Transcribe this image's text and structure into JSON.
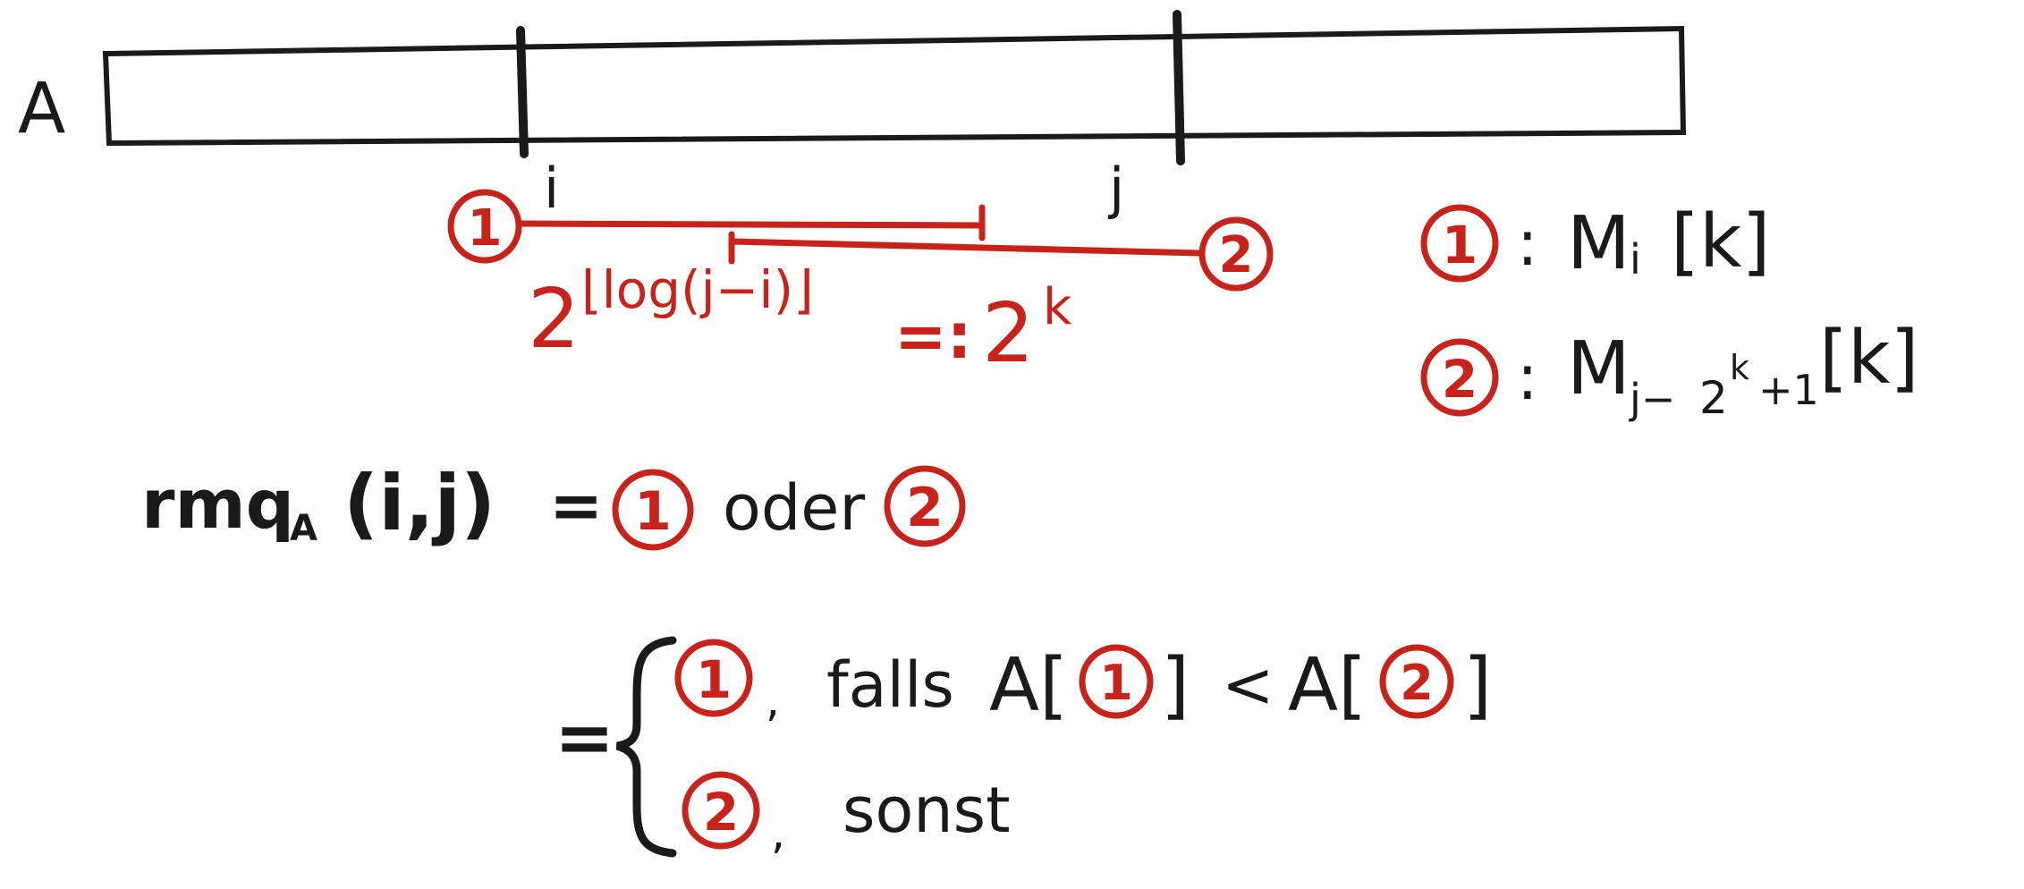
{
  "colors": {
    "ink": "#1a1a1a",
    "red": "#c8231b",
    "paper": "#ffffff"
  },
  "array": {
    "name": "A",
    "index_i": "i",
    "index_j": "j"
  },
  "markers": {
    "one": "1",
    "two": "2"
  },
  "span_label": {
    "base": "2",
    "exponent": "⌊log(j−i)⌋",
    "defines": "=:",
    "result_base": "2",
    "result_exp": "k"
  },
  "legend": {
    "item1": {
      "colon": ":",
      "symbol": "M",
      "subscript": "i",
      "bracket": "[k]"
    },
    "item2": {
      "colon": ":",
      "symbol": "M",
      "sub_a": "j−",
      "sub_b": "2",
      "sub_exp": "k",
      "sub_c": "+1",
      "bracket": "[k]"
    }
  },
  "formula": {
    "lhs_name": "rmq",
    "lhs_sub": "A",
    "lhs_args": "(i,j)",
    "equals": "=",
    "oder": "oder"
  },
  "cases": {
    "equals": "=",
    "row1_sep": ",",
    "row1_falls": "falls",
    "row1_a1": "A[",
    "row1_close1": "]",
    "row1_lt": "<",
    "row1_a2": "A[",
    "row1_close2": "]",
    "row2_sep": ",",
    "row2_sonst": "sonst"
  }
}
